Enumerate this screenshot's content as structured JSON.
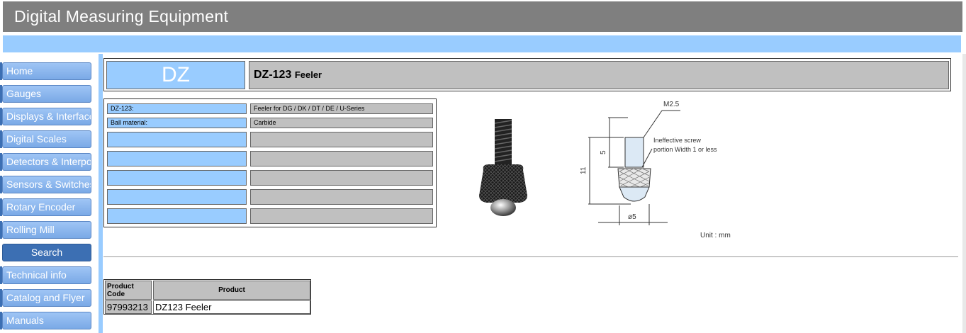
{
  "header": {
    "title": "Digital Measuring Equipment"
  },
  "sidebar": {
    "items": [
      {
        "label": "Home",
        "active": false
      },
      {
        "label": "Gauges",
        "active": false
      },
      {
        "label": "Displays & Interfaces",
        "active": false
      },
      {
        "label": "Digital Scales",
        "active": false
      },
      {
        "label": "Detectors & Interpolators",
        "active": false
      },
      {
        "label": "Sensors & Switches",
        "active": false
      },
      {
        "label": "Rotary Encoder",
        "active": false
      },
      {
        "label": "Rolling Mill",
        "active": false
      },
      {
        "label": "Search",
        "active": true
      },
      {
        "label": "Technical info",
        "active": false
      },
      {
        "label": "Catalog and Flyer",
        "active": false
      },
      {
        "label": "Manuals",
        "active": false
      }
    ]
  },
  "product": {
    "series_code": "DZ",
    "model": "DZ-123",
    "name": "Feeler"
  },
  "specs": [
    {
      "label": "DZ-123:",
      "value": "Feeler for DG / DK / DT / DE / U-Series"
    },
    {
      "label": "Ball material:",
      "value": "Carbide"
    },
    {
      "label": "",
      "value": ""
    },
    {
      "label": "",
      "value": ""
    },
    {
      "label": "",
      "value": ""
    },
    {
      "label": "",
      "value": ""
    }
  ],
  "drawing": {
    "thread_label": "M2.5",
    "note_line1": "Ineffective screw",
    "note_line2": "portion Width 1 or less",
    "dim_total": "11",
    "dim_thread": "5",
    "dim_diameter": "ø5",
    "unit": "Unit : mm"
  },
  "product_table": {
    "header_code": "Product Code",
    "header_product": "Product",
    "rows": [
      {
        "code": "97993213",
        "product": "DZ123 Feeler"
      }
    ]
  },
  "colors": {
    "header_bg": "#7f7f7f",
    "accent_blue": "#99ccff",
    "nav_active": "#3c6fb3",
    "cell_gray": "#c0c0c0"
  }
}
